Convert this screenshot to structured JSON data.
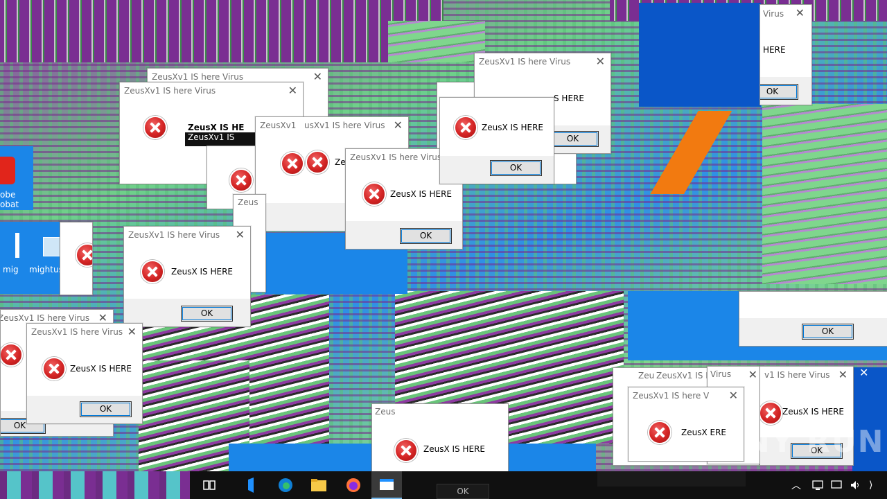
{
  "dialog": {
    "title": "ZeusXv1 IS here Virus",
    "message": "ZeusX IS HERE",
    "ok_label": "OK",
    "close_glyph": "✕"
  },
  "fragments": {
    "title_cut1": "ZeusXv1 IS here Virus",
    "title_cut2": "ZeusXv1 IS here Virus",
    "title_cut3": "usXv1 IS here Virus",
    "title_cut4": "ZeusXv1 IS here V",
    "title_cut5": "ZeusXv1 IS I",
    "title_cut6": "Virus",
    "title_cut7": "v1 IS here Virus",
    "title_cut8": "ZeusXv1 IS here Virus",
    "title_cut9": "ZeusXv1",
    "title_cut10": "Zeus",
    "title_cut11": "Zeu",
    "title_cut12": "Zeus",
    "title_cut13": "ZeusXv1 IS",
    "title_cut14": "ZeusX IS HE",
    "title_cut15": "ZeusXv1 IS here Virus",
    "title_cut16": "Virus",
    "msg_cut1": "S HERE",
    "msg_cut2": "HERE",
    "msg_cut3": "Ze",
    "msg_cut4": "ZeusX IS HERE",
    "msg_cut5": "ZeusX ERE",
    "msg_cut6": "E",
    "msg_cut7": "ZeusX IS HERE",
    "msg_cut8": "ZeusX IS HERE",
    "ok_label": "OK",
    "ok_label_cut": "OK"
  },
  "desktop_icons": [
    {
      "label": "obe\nobat",
      "icon": "acrobat-icon"
    },
    {
      "label": "mig",
      "icon": "file-icon"
    },
    {
      "label": "mightus",
      "icon": "image-file-icon"
    }
  ],
  "watermark": "ANY RUN",
  "taskbar": {
    "items": [
      "task-view-icon",
      "cortana-icon",
      "edge-icon",
      "file-explorer-icon",
      "firefox-icon",
      "window-app-icon"
    ],
    "active_index": 5,
    "colors": {
      "background": "#101010",
      "active": "#3a3a3a",
      "accent": "#76b9ed"
    }
  },
  "colors": {
    "desktop_blue": "#1b86e8",
    "glitch_purple": "#7a2e92",
    "glitch_green": "#7fd68d",
    "error_red": "#d42424",
    "dialog_footer": "#f0f0f0"
  }
}
